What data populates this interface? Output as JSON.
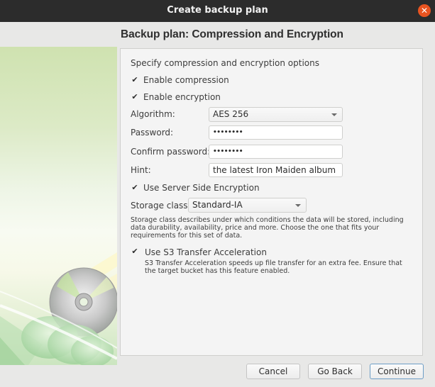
{
  "window": {
    "title": "Create backup plan",
    "close_icon": "✕"
  },
  "page_title": "Backup plan: Compression and Encryption",
  "form": {
    "intro": "Specify compression and encryption options",
    "enable_compression": {
      "label": "Enable compression",
      "checked": true,
      "mark": "✔"
    },
    "enable_encryption": {
      "label": "Enable encryption",
      "checked": true,
      "mark": "✔"
    },
    "algorithm": {
      "label": "Algorithm:",
      "value": "AES 256"
    },
    "password": {
      "label": "Password:",
      "value": "••••••••"
    },
    "confirm_password": {
      "label": "Confirm password:",
      "value": "••••••••"
    },
    "hint": {
      "label": "Hint:",
      "value": "the latest Iron Maiden album"
    },
    "server_side_encryption": {
      "label": "Use Server Side Encryption",
      "checked": true,
      "mark": "✔"
    },
    "storage_class": {
      "label": "Storage class:",
      "value": "Standard-IA",
      "description_lines": [
        "Storage class describes under which conditions the data will be stored, including",
        "data durability, availability, price and more. Choose the one that fits your",
        "requirements for this set of data."
      ]
    },
    "transfer_acceleration": {
      "label": "Use S3 Transfer Acceleration",
      "checked": true,
      "mark": "✔",
      "description_lines": [
        "S3 Transfer Acceleration speeds up file transfer for an extra fee. Ensure that",
        "the target bucket has this feature enabled."
      ]
    }
  },
  "buttons": {
    "cancel": "Cancel",
    "go_back": "Go Back",
    "continue": "Continue"
  },
  "colors": {
    "titlebar": "#2c2c2c",
    "close_button": "#e95420",
    "default_button_border": "#6d9ec6"
  }
}
